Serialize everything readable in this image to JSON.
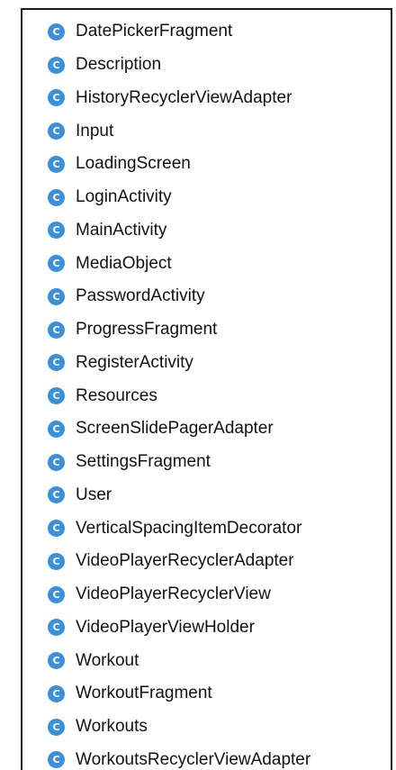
{
  "icon": {
    "name": "class-icon",
    "letter": "C",
    "color": "#3d8fd6"
  },
  "classes": [
    "DatePickerFragment",
    "Description",
    "HistoryRecyclerViewAdapter",
    "Input",
    "LoadingScreen",
    "LoginActivity",
    "MainActivity",
    "MediaObject",
    "PasswordActivity",
    "ProgressFragment",
    "RegisterActivity",
    "Resources",
    "ScreenSlidePagerAdapter",
    "SettingsFragment",
    "User",
    "VerticalSpacingItemDecorator",
    "VideoPlayerRecyclerAdapter",
    "VideoPlayerRecyclerView",
    "VideoPlayerViewHolder",
    "Workout",
    "WorkoutFragment",
    "Workouts",
    "WorkoutsRecyclerViewAdapter"
  ]
}
